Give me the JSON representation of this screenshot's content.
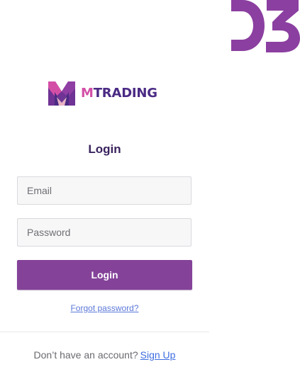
{
  "brand": {
    "logo_m": "M",
    "logo_rest": "TRADING",
    "colors": {
      "purple": "#844299",
      "deep_purple": "#4b2a84",
      "pink": "#d34fa6"
    }
  },
  "corner_badge": {
    "text": "03"
  },
  "login": {
    "title": "Login",
    "email_placeholder": "Email",
    "email_value": "",
    "password_placeholder": "Password",
    "password_value": "",
    "button_label": "Login",
    "forgot_password": "Forgot password?"
  },
  "signup": {
    "prompt": "Don’t have an account?",
    "link": "Sign Up"
  },
  "icons": {
    "logo": "mtrading-logo-icon",
    "corner": "brand-corner-mark-icon"
  }
}
